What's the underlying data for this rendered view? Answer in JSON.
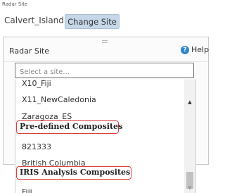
{
  "header": {
    "small_label": "Radar Site",
    "current_site": "Calvert_Island",
    "change_button": "Change Site"
  },
  "dialog": {
    "title": "Radar Site",
    "help_label": "Help",
    "search_placeholder": "Select a site..."
  },
  "list": {
    "items": [
      "X10_Fiji",
      "X11_NewCaledonia",
      "Zaragoza_ES"
    ],
    "groups": [
      "Pre-defined Composites",
      "IRIS Analysis Composites"
    ],
    "composite_items": [
      "821333",
      "British Columbia"
    ],
    "iris_items": [
      "Fiji"
    ]
  }
}
